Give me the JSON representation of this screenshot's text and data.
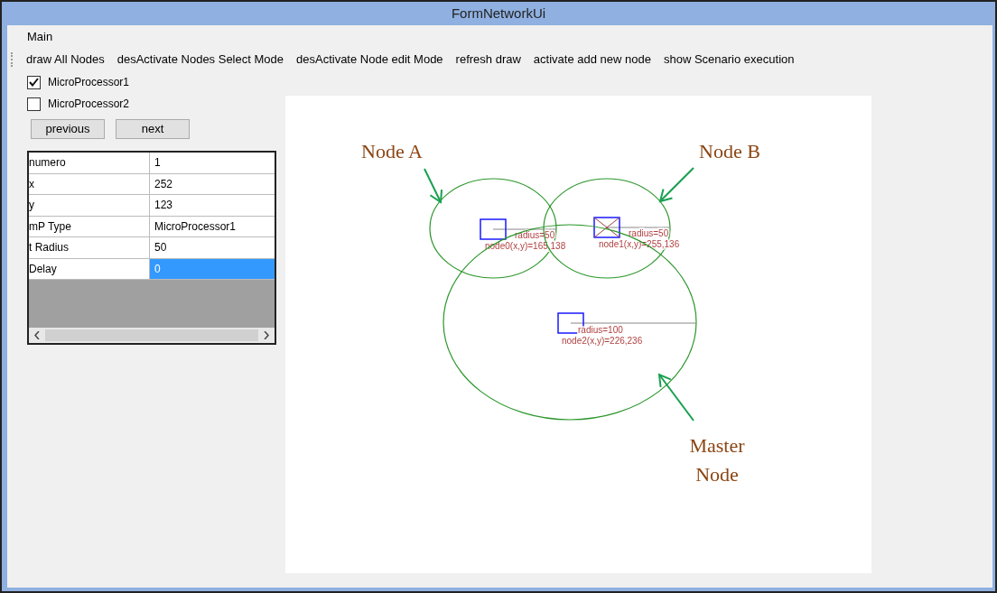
{
  "window": {
    "title": "FormNetworkUi"
  },
  "menu": [
    "Main"
  ],
  "toolbar": [
    "draw All Nodes",
    "desActivate Nodes Select Mode",
    "desActivate Node edit Mode",
    "refresh draw",
    "activate add new node",
    "show Scenario execution"
  ],
  "checkboxes": [
    {
      "label": "MicroProcessor1",
      "checked": true
    },
    {
      "label": "MicroProcessor2",
      "checked": false
    }
  ],
  "buttons": [
    "previous",
    "next"
  ],
  "properties": [
    {
      "name": "numero",
      "value": "1",
      "selected": false
    },
    {
      "name": "x",
      "value": "252",
      "selected": false
    },
    {
      "name": "y",
      "value": "123",
      "selected": false
    },
    {
      "name": "mP Type",
      "value": "MicroProcessor1",
      "selected": false
    },
    {
      "name": "t Radius",
      "value": "50",
      "selected": false
    },
    {
      "name": "Delay",
      "value": "0",
      "selected": true
    }
  ],
  "canvas": {
    "nodes": [
      {
        "radius_label": "radius=50",
        "position_label": "node0(x,y)=165,138",
        "crossed": false
      },
      {
        "radius_label": "radius=50",
        "position_label": "node1(x,y)=255,136",
        "crossed": true
      },
      {
        "radius_label": "radius=100",
        "position_label": "node2(x,y)=226,236",
        "crossed": false
      }
    ],
    "annotations": [
      {
        "lines": [
          "Node A"
        ]
      },
      {
        "lines": [
          "Node B"
        ]
      },
      {
        "lines": [
          "Master",
          "Node"
        ]
      }
    ]
  }
}
